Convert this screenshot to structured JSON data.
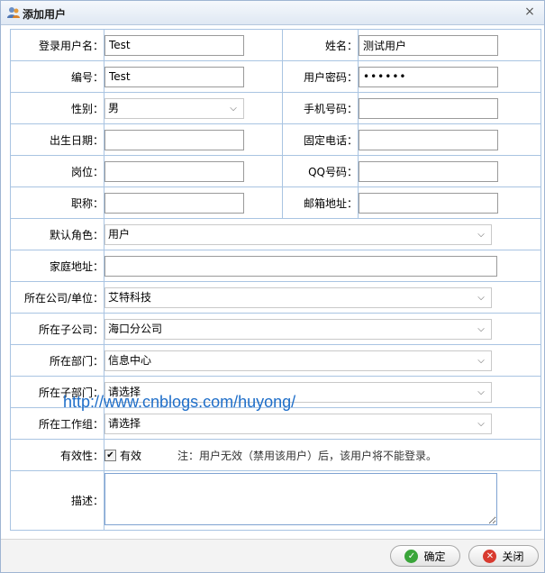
{
  "dialog": {
    "title": "添加用户",
    "close_glyph": "×"
  },
  "labels": {
    "login_name": "登录用户名：",
    "name": "姓名：",
    "code": "编号：",
    "password": "用户密码：",
    "gender": "性别：",
    "mobile": "手机号码：",
    "birthday": "出生日期：",
    "phone": "固定电话：",
    "post": "岗位：",
    "qq": "QQ号码：",
    "title": "职称：",
    "email": "邮箱地址：",
    "role": "默认角色：",
    "address": "家庭地址：",
    "company": "所在公司/单位：",
    "subcompany": "所在子公司：",
    "department": "所在部门：",
    "subdepartment": "所在子部门：",
    "workgroup": "所在工作组：",
    "validity": "有效性：",
    "description": "描述："
  },
  "values": {
    "login_name": "Test",
    "name": "测试用户",
    "code": "Test",
    "password": "••••••",
    "gender": "男",
    "mobile": "",
    "birthday": "",
    "phone": "",
    "post": "",
    "qq": "",
    "title": "",
    "email": "",
    "role": "用户",
    "address": "",
    "company": "艾特科技",
    "subcompany": "海口分公司",
    "department": "信息中心",
    "subdepartment": "请选择",
    "workgroup": "请选择",
    "valid_label": "有效",
    "valid_checked": true,
    "description": ""
  },
  "note": "注：用户无效（禁用该用户）后，该用户将不能登录。",
  "watermark": "http://www.cnblogs.com/huyong/",
  "buttons": {
    "ok": "确定",
    "cancel": "关闭"
  },
  "icons": {
    "title": "users-icon",
    "chevron": "chevron-down-icon",
    "ok": "check-icon",
    "cancel": "close-circle-icon"
  },
  "colors": {
    "border": "#a9c4e2",
    "watermark": "#1e6ec9",
    "ok": "#3aa53a",
    "cancel": "#d83a2f"
  }
}
